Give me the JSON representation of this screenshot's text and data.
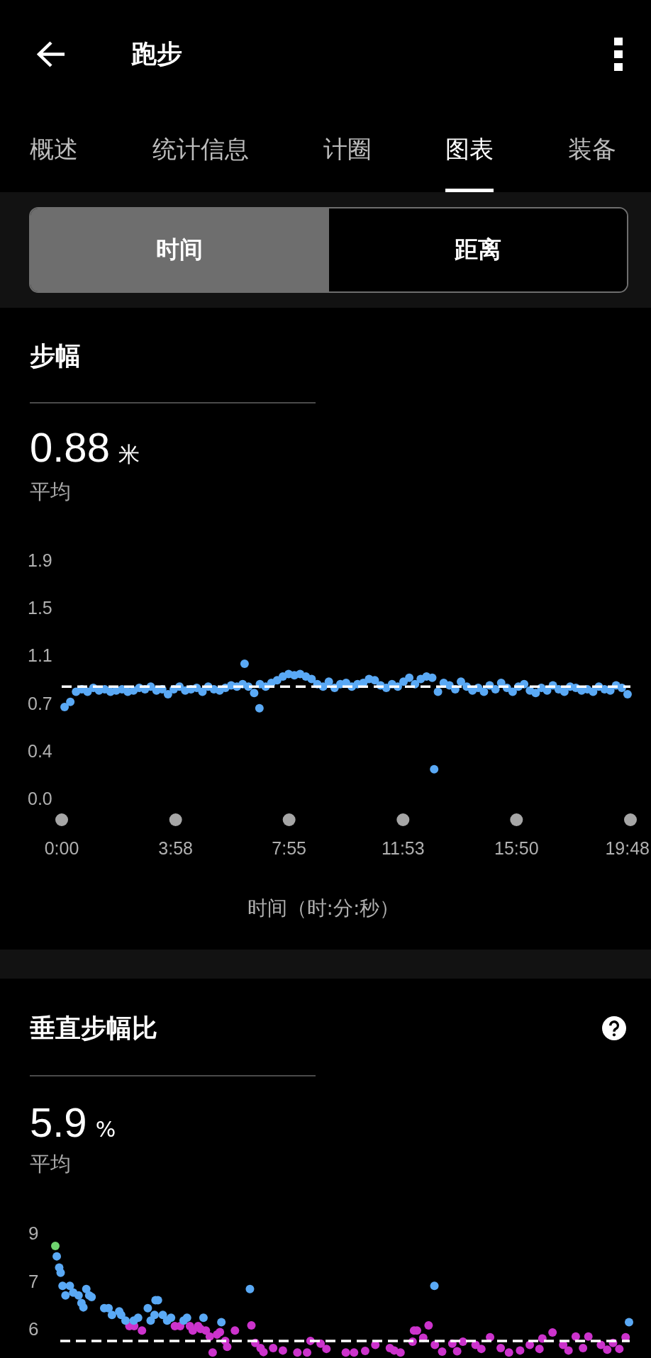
{
  "header": {
    "title": "跑步"
  },
  "tabs": [
    {
      "label": "概述",
      "selected": false
    },
    {
      "label": "统计信息",
      "selected": false
    },
    {
      "label": "计圈",
      "selected": false
    },
    {
      "label": "图表",
      "selected": true
    },
    {
      "label": "装备",
      "selected": false
    }
  ],
  "segments": [
    {
      "label": "时间",
      "selected": true
    },
    {
      "label": "距离",
      "selected": false
    }
  ],
  "sections": [
    {
      "title": "步幅",
      "value": "0.88",
      "unit": "米",
      "caption": "平均",
      "chart_data": {
        "type": "scatter",
        "xlabel": "时间（时:分:秒）",
        "xlim": [
          0,
          1188
        ],
        "ylim": [
          0,
          1.875
        ],
        "xticks": [
          {
            "value": 0,
            "label": "0:00"
          },
          {
            "value": 238,
            "label": "3:58"
          },
          {
            "value": 475,
            "label": "7:55"
          },
          {
            "value": 713,
            "label": "11:53"
          },
          {
            "value": 950,
            "label": "15:50"
          },
          {
            "value": 1188,
            "label": "19:48"
          }
        ],
        "yticks": [
          {
            "value": 0,
            "label": "0.0"
          },
          {
            "value": 0.375,
            "label": "0.4"
          },
          {
            "value": 0.75,
            "label": "0.7"
          },
          {
            "value": 1.125,
            "label": "1.1"
          },
          {
            "value": 1.5,
            "label": "1.5"
          },
          {
            "value": 1.875,
            "label": "1.9"
          }
        ],
        "x": [
          6,
          18,
          30,
          42,
          54,
          66,
          78,
          90,
          102,
          114,
          126,
          138,
          150,
          162,
          174,
          186,
          198,
          210,
          222,
          234,
          246,
          258,
          270,
          282,
          294,
          306,
          318,
          330,
          342,
          354,
          366,
          378,
          382,
          390,
          402,
          413,
          414,
          426,
          438,
          450,
          462,
          474,
          486,
          498,
          510,
          522,
          534,
          546,
          558,
          570,
          582,
          594,
          606,
          618,
          630,
          642,
          654,
          666,
          678,
          690,
          702,
          714,
          726,
          738,
          750,
          762,
          774,
          778,
          786,
          798,
          810,
          822,
          834,
          846,
          858,
          870,
          882,
          894,
          906,
          918,
          930,
          942,
          954,
          966,
          978,
          990,
          1002,
          1014,
          1026,
          1038,
          1050,
          1062,
          1074,
          1086,
          1098,
          1110,
          1122,
          1134,
          1146,
          1158,
          1170,
          1182
        ],
        "series": [
          {
            "color": "#5aa9f5",
            "values": [
              0.72,
              0.76,
              0.84,
              0.86,
              0.84,
              0.87,
              0.85,
              0.86,
              0.84,
              0.85,
              0.86,
              0.84,
              0.85,
              0.87,
              0.86,
              0.88,
              0.85,
              0.86,
              0.82,
              0.86,
              0.88,
              0.85,
              0.86,
              0.87,
              0.84,
              0.88,
              0.86,
              0.85,
              0.87,
              0.89,
              0.88,
              0.9,
              1.06,
              0.88,
              0.83,
              0.71,
              0.9,
              0.88,
              0.91,
              0.93,
              0.96,
              0.98,
              0.97,
              0.98,
              0.96,
              0.94,
              0.9,
              0.88,
              0.92,
              0.87,
              0.9,
              0.91,
              0.88,
              0.9,
              0.91,
              0.94,
              0.93,
              0.89,
              0.87,
              0.9,
              0.88,
              0.92,
              0.95,
              0.9,
              0.94,
              0.96,
              0.95,
              0.23,
              0.84,
              0.91,
              0.89,
              0.86,
              0.92,
              0.88,
              0.85,
              0.87,
              0.84,
              0.89,
              0.86,
              0.91,
              0.87,
              0.84,
              0.88,
              0.9,
              0.85,
              0.83,
              0.87,
              0.85,
              0.89,
              0.86,
              0.84,
              0.88,
              0.87,
              0.85,
              0.86,
              0.84,
              0.88,
              0.86,
              0.85,
              0.89,
              0.87,
              0.82
            ]
          }
        ],
        "ref_lines": [
          {
            "axis": "y",
            "value": 0.88
          }
        ]
      }
    },
    {
      "title": "垂直步幅比",
      "help": true,
      "value": "5.9",
      "unit": "%",
      "caption": "平均",
      "y_axis_labels": [
        "9",
        "7",
        "6"
      ]
    }
  ]
}
